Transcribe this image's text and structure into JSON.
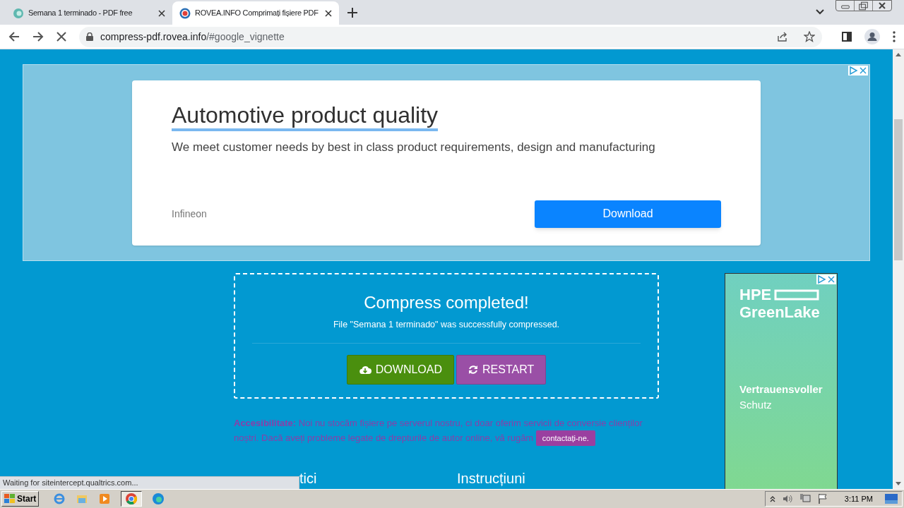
{
  "browser": {
    "tabs": [
      {
        "title": "Semana 1 terminado - PDF free",
        "selected": false
      },
      {
        "title": "ROVEA.INFO Comprimați fișiere PDF",
        "selected": true
      }
    ],
    "address": {
      "host": "compress-pdf.rovea.info",
      "path": "/#google_vignette"
    }
  },
  "top_ad": {
    "headline": "Automotive product quality",
    "text": "We meet customer needs by best in class product requirements, design and manufacturing",
    "advertiser": "Infineon",
    "button": "Download"
  },
  "result": {
    "title": "Compress completed!",
    "message": "File \"Semana 1 terminado\" was successfully compressed.",
    "buttons": [
      {
        "label": "DOWNLOAD",
        "kind": "download"
      },
      {
        "label": "RESTART",
        "kind": "restart"
      }
    ]
  },
  "notice": {
    "text": "**Accesibilitate:** Noi nu stocăm fișiere pe serverul nostru, ci doar oferim servicii de conversie clienților noștri. Dacă aveți probleme legate de drepturile de autor online, vă rugăm",
    "link": "contactați-ne."
  },
  "headings": [
    "tici",
    "Instrucțiuni"
  ],
  "side_ad": {
    "brand_line1": "HPE",
    "brand_line2": "GreenLake",
    "tagline_1": "Vertrauensvoller",
    "tagline_2": "Schutz"
  },
  "status_text": "Waiting for siteintercept.qualtrics.com...",
  "taskbar": {
    "start": "Start",
    "clock": "3:11 PM"
  }
}
